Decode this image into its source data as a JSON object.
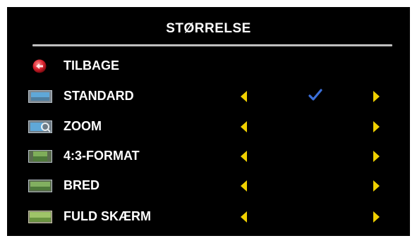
{
  "menu": {
    "title": "STØRRELSE",
    "items": [
      {
        "label": "TILBAGE",
        "icon": "back-icon"
      },
      {
        "label": "STANDARD",
        "icon": "standard-screen-icon",
        "selected": true
      },
      {
        "label": "ZOOM",
        "icon": "zoom-screen-icon"
      },
      {
        "label": "4:3-FORMAT",
        "icon": "aspect-4-3-icon"
      },
      {
        "label": "BRED",
        "icon": "wide-screen-icon"
      },
      {
        "label": "FULD SKÆRM",
        "icon": "full-screen-icon"
      }
    ]
  },
  "colors": {
    "background": "#000000",
    "text": "#ffffff",
    "arrow": "#f0d000",
    "checkmark": "#3b6fd9",
    "back_icon": "#e0303a"
  }
}
